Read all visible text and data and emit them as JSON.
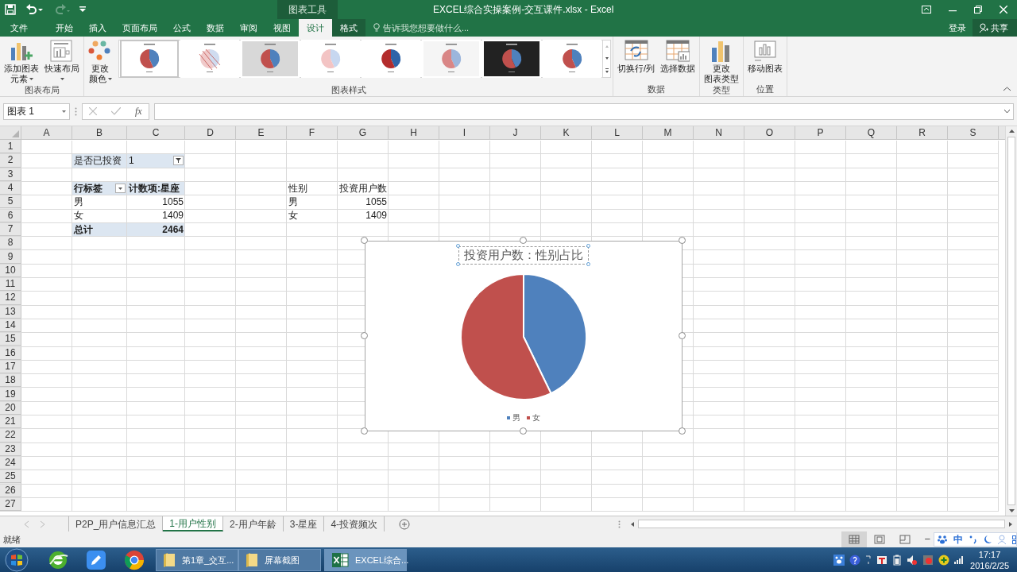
{
  "window": {
    "title": "EXCEL综合实操案例-交互课件.xlsx - Excel",
    "context_group": "图表工具"
  },
  "ribbon_tabs": [
    {
      "label": "文件",
      "selected": false
    },
    {
      "label": "开始",
      "selected": false
    },
    {
      "label": "插入",
      "selected": false
    },
    {
      "label": "页面布局",
      "selected": false
    },
    {
      "label": "公式",
      "selected": false
    },
    {
      "label": "数据",
      "selected": false
    },
    {
      "label": "审阅",
      "selected": false
    },
    {
      "label": "视图",
      "selected": false
    },
    {
      "label": "设计",
      "selected": true
    },
    {
      "label": "格式",
      "selected": false
    }
  ],
  "tell_me": {
    "placeholder": "告诉我您想要做什么..."
  },
  "account": {
    "sign_in": "登录",
    "share": "共享"
  },
  "ribbon_groups": [
    {
      "label": "图表布局",
      "buttons": [
        {
          "kind": "add-element",
          "lines": [
            "添加图表",
            "元素"
          ],
          "dropdown": true
        },
        {
          "kind": "layout",
          "lines": [
            "快速布局"
          ],
          "dropdown": true
        }
      ]
    },
    {
      "label": "图表样式",
      "buttons": [
        {
          "kind": "colors",
          "lines": [
            "更改",
            "颜色"
          ],
          "dropdown": true
        }
      ],
      "gallery": [
        {
          "kind": "plain",
          "selected": true
        },
        {
          "kind": "striped",
          "selected": false
        },
        {
          "kind": "gradient",
          "selected": false
        },
        {
          "kind": "pastel",
          "selected": false
        },
        {
          "kind": "bold",
          "selected": false
        },
        {
          "kind": "hatched",
          "selected": false
        },
        {
          "kind": "dark",
          "selected": false
        },
        {
          "kind": "labels",
          "selected": false
        }
      ]
    },
    {
      "label": "数据",
      "buttons": [
        {
          "kind": "switch",
          "lines": [
            "切换行/列"
          ],
          "dropdown": false
        },
        {
          "kind": "select",
          "lines": [
            "选择数据"
          ],
          "dropdown": false
        }
      ]
    },
    {
      "label": "类型",
      "buttons": [
        {
          "kind": "change-type",
          "lines": [
            "更改",
            "图表类型"
          ],
          "dropdown": false
        }
      ]
    },
    {
      "label": "位置",
      "buttons": [
        {
          "kind": "move",
          "lines": [
            "移动图表"
          ],
          "dropdown": false
        }
      ]
    }
  ],
  "name_box": "图表 1",
  "function_button": "fx",
  "columns": [
    "A",
    "B",
    "C",
    "D",
    "E",
    "F",
    "G",
    "H",
    "I",
    "J",
    "K",
    "L",
    "M",
    "N",
    "O",
    "P",
    "Q",
    "R",
    "S"
  ],
  "rows": [
    "1",
    "2",
    "3",
    "4",
    "5",
    "6",
    "7",
    "8",
    "9",
    "10",
    "11",
    "12",
    "13",
    "14",
    "15",
    "16",
    "17",
    "18",
    "19",
    "20",
    "21",
    "22",
    "23",
    "24",
    "25",
    "26",
    "27"
  ],
  "pivot_table": {
    "filter": {
      "label": "是否已投资",
      "value": "1"
    },
    "headers": [
      "行标签",
      "计数项:星座"
    ],
    "rows": [
      {
        "label": "男",
        "value": "1055"
      },
      {
        "label": "女",
        "value": "1409"
      }
    ],
    "total": {
      "label": "总计",
      "value": "2464"
    }
  },
  "data_table": {
    "headers": [
      "性别",
      "投资用户数"
    ],
    "rows": [
      {
        "label": "男",
        "value": "1055"
      },
      {
        "label": "女",
        "value": "1409"
      }
    ]
  },
  "chart": {
    "selected": true,
    "slices": [
      {
        "color": "#4f81bd"
      },
      {
        "color": "#c0504d"
      }
    ],
    "chart_data": {
      "type": "pie",
      "title": "投资用户数：性别占比",
      "categories": [
        "男",
        "女"
      ],
      "legend": "bottom",
      "series": [
        {
          "values": [
            42.82,
            57.18
          ]
        }
      ]
    }
  },
  "sheet_tabs": [
    {
      "label": "P2P_用户信息汇总",
      "selected": false
    },
    {
      "label": "1-用户性别",
      "selected": true
    },
    {
      "label": "2-用户年龄",
      "selected": false
    },
    {
      "label": "3-星座",
      "selected": false
    },
    {
      "label": "4-投资频次",
      "selected": false
    }
  ],
  "status_bar": {
    "text": "就绪",
    "views": [
      {
        "kind": "normal",
        "selected": true
      },
      {
        "kind": "page-layout",
        "selected": false
      },
      {
        "kind": "page-break",
        "selected": false
      }
    ],
    "zoom_out": "−"
  },
  "ime_bar": {
    "language": "中"
  },
  "taskbar": {
    "windows": [
      {
        "kind": "folder",
        "label": "第1章_交互...",
        "active": false
      },
      {
        "kind": "folder",
        "label": "屏幕截图",
        "active": false
      },
      {
        "kind": "excel",
        "label": "EXCEL综合...",
        "active": true
      }
    ],
    "time": "17:17",
    "date": "2016/2/25"
  }
}
